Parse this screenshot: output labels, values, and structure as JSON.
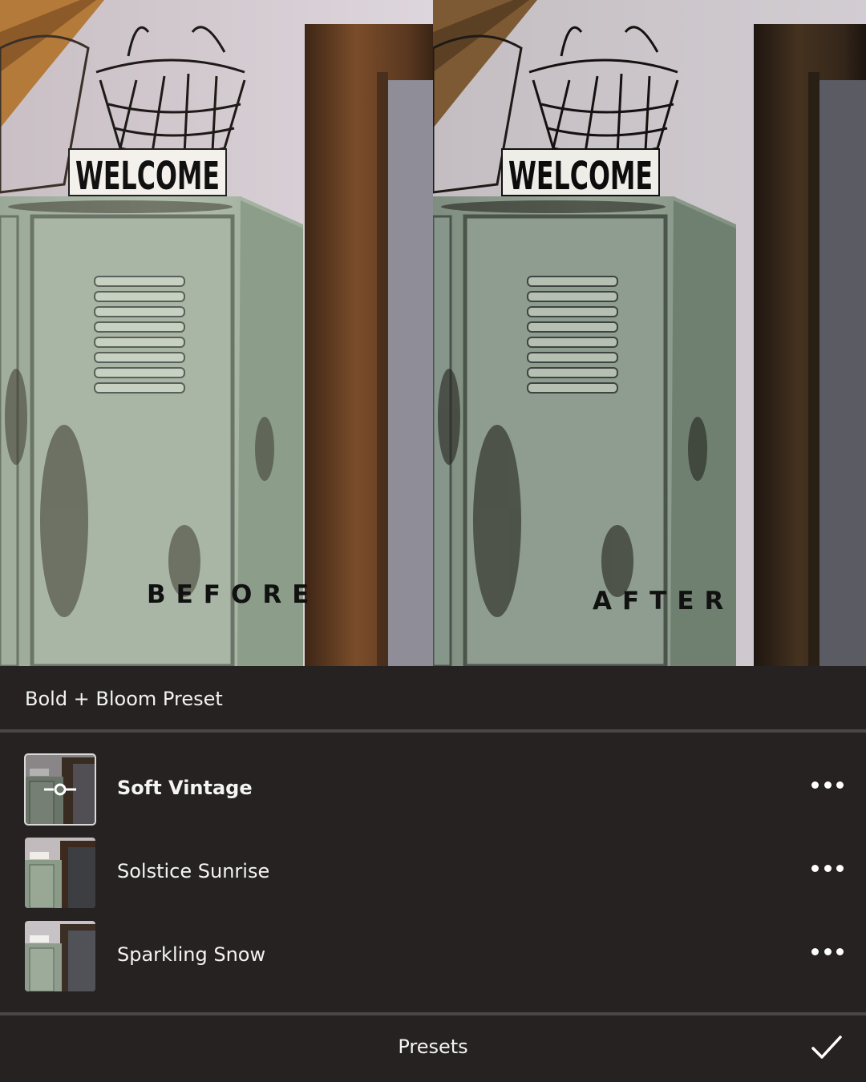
{
  "photo": {
    "before_label": "BEFORE",
    "after_label": "AFTER",
    "sign_text": "WELCOME"
  },
  "preset_group": {
    "title": "Bold + Bloom Preset"
  },
  "presets": [
    {
      "name": "Soft Vintage",
      "selected": true,
      "icon": "adjust-slider-icon"
    },
    {
      "name": "Solstice Sunrise",
      "selected": false
    },
    {
      "name": "Sparkling Snow",
      "selected": false
    }
  ],
  "bottom_bar": {
    "title": "Presets",
    "confirm_icon": "checkmark-icon"
  },
  "colors": {
    "panel_bg": "#262221",
    "divider": "#4a4746",
    "text": "#ffffff"
  }
}
